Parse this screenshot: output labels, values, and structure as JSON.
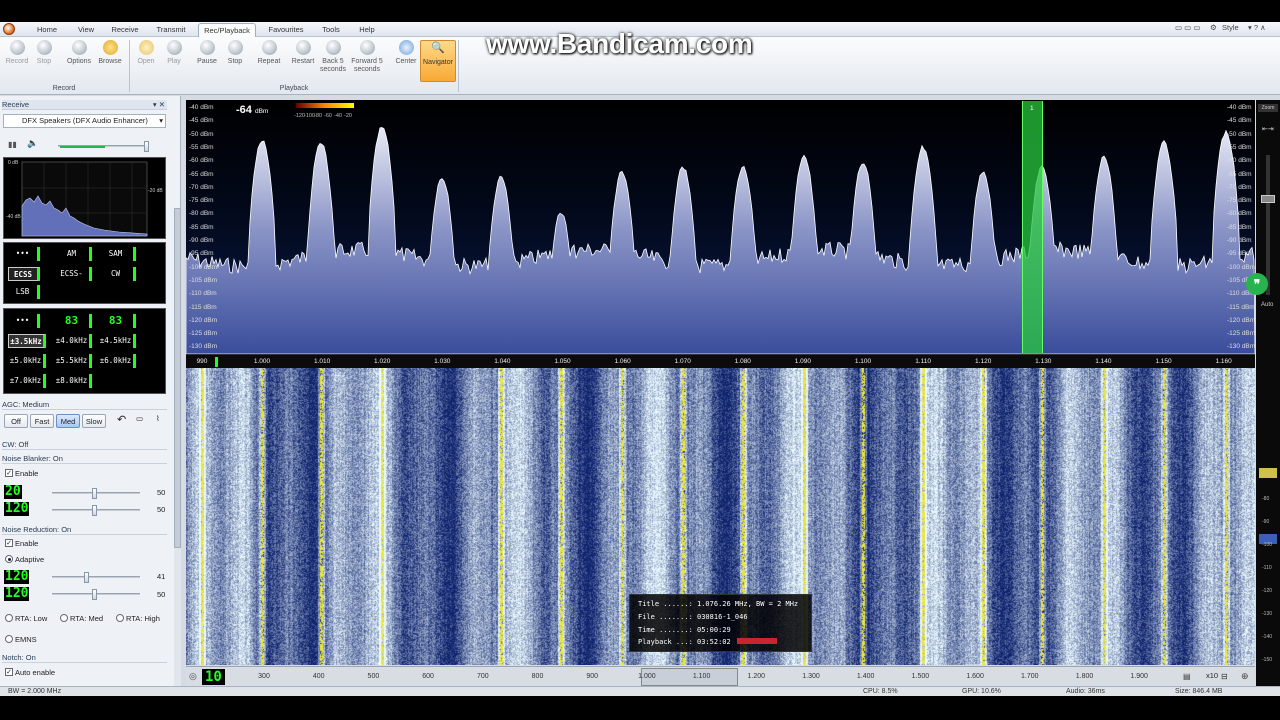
{
  "watermark": "www.Bandicam.com",
  "menu": {
    "tabs": [
      "Home",
      "View",
      "Receive",
      "Transmit",
      "Rec/Playback",
      "Favourites",
      "Tools",
      "Help"
    ],
    "style_label": "Style"
  },
  "ribbon": {
    "record_group": {
      "label": "Record",
      "record": "Record",
      "stop": "Stop",
      "options": "Options",
      "browse": "Browse"
    },
    "playback_group": {
      "label": "Playback",
      "open": "Open",
      "play": "Play",
      "pause": "Pause",
      "stop": "Stop",
      "repeat": "Repeat",
      "restart": "Restart",
      "back": "Back 5 seconds",
      "forward": "Forward 5 seconds",
      "center": "Center",
      "navigator": "Navigator"
    }
  },
  "left": {
    "receive_header": "Receive",
    "audio_device": "DFX Speakers (DFX Audio Enhancer)",
    "audio_db_labels": [
      "0 dB",
      "-20 dB",
      "-40 dB"
    ],
    "modes": [
      "•••",
      "AM",
      "SAM",
      "ECSS",
      "ECSS-",
      "CW",
      "LSB"
    ],
    "bandwidths": [
      "•••",
      "83",
      "83",
      "±3.5kHz",
      "±4.0kHz",
      "±4.5kHz",
      "±5.0kHz",
      "±5.5kHz",
      "±6.0kHz",
      "±7.0kHz",
      "±8.0kHz"
    ],
    "agc_header": "AGC: Medium",
    "agc_buttons": [
      "Off",
      "Fast",
      "Med",
      "Slow"
    ],
    "cw_header": "CW: Off",
    "nb_header": "Noise Blanker: On",
    "nb_enable": "Enable",
    "nb_lcd1": "20",
    "nb_lcd2": "120",
    "nb_val1": "50",
    "nb_val2": "50",
    "nr_header": "Noise Reduction: On",
    "nr_enable": "Enable",
    "nr_adaptive": "Adaptive",
    "nr_lcd1": "120",
    "nr_lcd2": "120",
    "nr_val1": "41",
    "nr_val2": "50",
    "rta": [
      "RTA: Low",
      "RTA: Med",
      "RTA: High"
    ],
    "emns": "EMNS",
    "notch_header": "Notch: On",
    "notch_auto": "Auto enable"
  },
  "spectrum": {
    "signal_value": "-64",
    "signal_unit": "dBm",
    "signal_ticks": [
      "-120",
      "-100",
      "-80",
      "-60",
      "-40",
      "-20"
    ],
    "dbm_labels": [
      "-40 dBm",
      "-45 dBm",
      "-50 dBm",
      "-55 dBm",
      "-60 dBm",
      "-65 dBm",
      "-70 dBm",
      "-75 dBm",
      "-80 dBm",
      "-85 dBm",
      "-90 dBm",
      "-95 dBm",
      "-100 dBm",
      "-105 dBm",
      "-110 dBm",
      "-115 dBm",
      "-120 dBm",
      "-125 dBm",
      "-130 dBm"
    ],
    "tuned_marker": "1",
    "freq_labels": [
      "990",
      "1.000",
      "1.010",
      "1.020",
      "1.030",
      "1.040",
      "1.050",
      "1.060",
      "1.070",
      "1.080",
      "1.090",
      "1.100",
      "1.110",
      "1.120",
      "1.130",
      "1.140",
      "1.150",
      "1.160"
    ],
    "fill_top": "#e8eaf5",
    "fill_bottom": "#3a4d9c"
  },
  "info": {
    "title": "Title ......: 1.076.26 MHz, BW = 2 MHz",
    "file": "File .......: 030816-1_046",
    "time": "Time .......: 05:00:29",
    "playback": "Playback ...: 03:52:02",
    "playback_progress": 0.55
  },
  "navigator": {
    "lcd": "10",
    "labels": [
      "300",
      "400",
      "500",
      "600",
      "700",
      "800",
      "900",
      "1.000",
      "1.100",
      "1.200",
      "1.300",
      "1.400",
      "1.500",
      "1.600",
      "1.700",
      "1.800",
      "1.900"
    ],
    "zoom": "x10"
  },
  "rightcol": {
    "zoom_label": "Zoom",
    "auto_label": "Auto",
    "ticks": [
      "-80",
      "-90",
      "-100",
      "-110",
      "-120",
      "-130",
      "-140",
      "-150"
    ]
  },
  "status": {
    "bw": "BW = 2.000 MHz",
    "cpu": "CPU: 8.5%",
    "gpu": "GPU: 10.6%",
    "audio": "Audio: 36ms",
    "size": "Size: 846.4 MB"
  }
}
